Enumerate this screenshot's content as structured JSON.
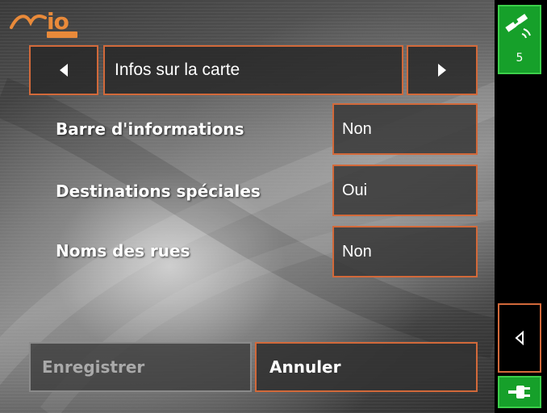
{
  "header": {
    "logo_text": "io",
    "nav_title": "Infos sur la carte"
  },
  "settings": [
    {
      "label": "Barre d'informations",
      "value": "Non"
    },
    {
      "label": "Destinations spéciales",
      "value": "Oui"
    },
    {
      "label": "Noms des rues",
      "value": "Non"
    }
  ],
  "actions": {
    "save_label": "Enregistrer",
    "cancel_label": "Annuler"
  },
  "sidebar": {
    "satellite_count": "5"
  },
  "colors": {
    "accent_border": "#d2693a",
    "status_green": "#16a02a",
    "logo_orange": "#e98a3a"
  }
}
